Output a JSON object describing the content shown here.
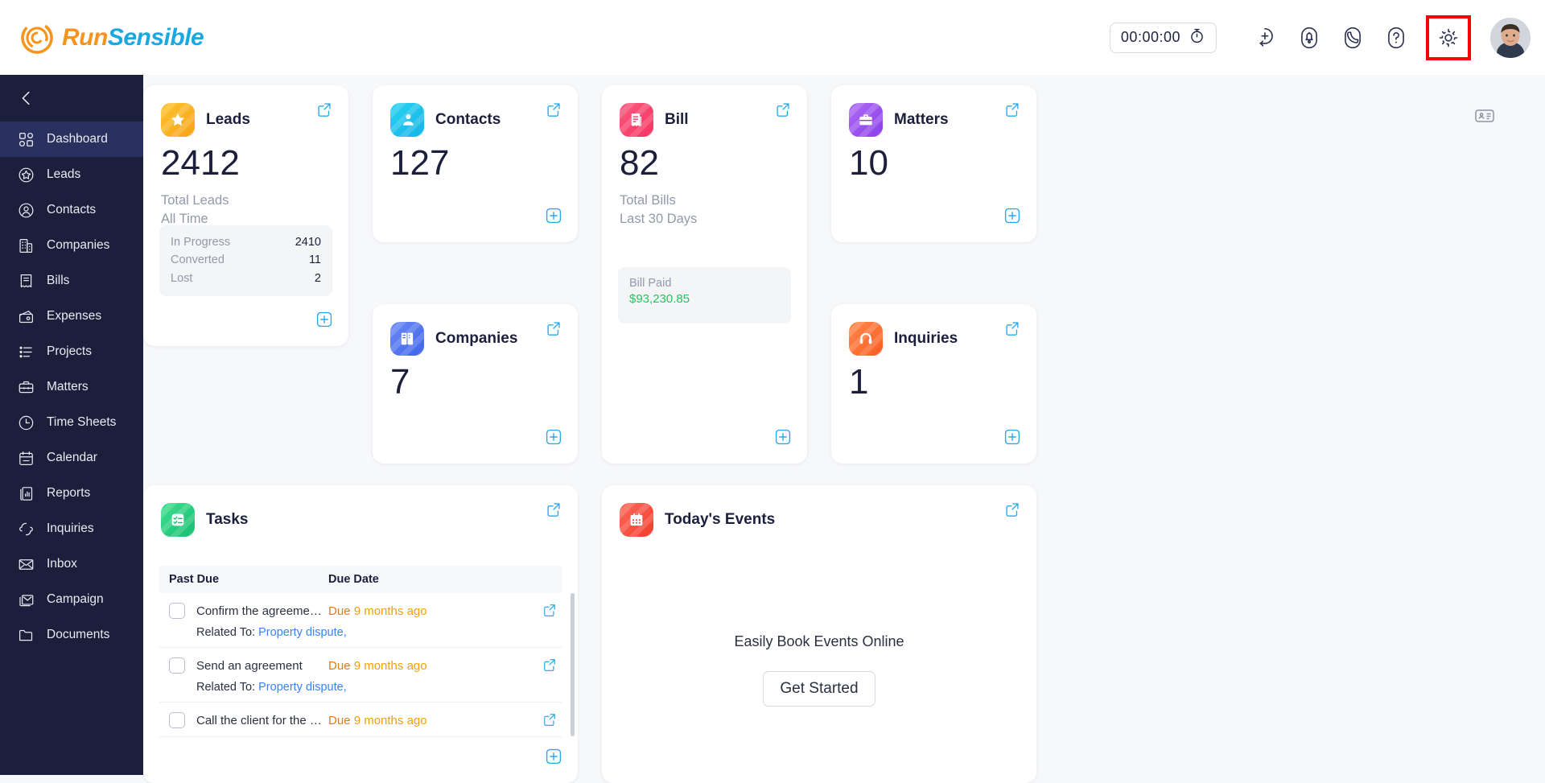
{
  "brand": {
    "run": "Run",
    "sensible": "Sensible"
  },
  "header": {
    "timer": "00:00:00",
    "icons": [
      {
        "name": "stopwatch-icon"
      },
      {
        "name": "add-circle-icon"
      },
      {
        "name": "bell-icon"
      },
      {
        "name": "phone-icon"
      },
      {
        "name": "help-icon"
      },
      {
        "name": "gear-icon"
      },
      {
        "name": "avatar"
      }
    ]
  },
  "sidebar": {
    "collapse": "collapse-icon",
    "items": [
      {
        "label": "Dashboard",
        "icon": "dashboard-icon",
        "active": true
      },
      {
        "label": "Leads",
        "icon": "star-icon",
        "active": false
      },
      {
        "label": "Contacts",
        "icon": "person-icon",
        "active": false
      },
      {
        "label": "Companies",
        "icon": "building-icon",
        "active": false
      },
      {
        "label": "Bills",
        "icon": "receipt-icon",
        "active": false
      },
      {
        "label": "Expenses",
        "icon": "wallet-icon",
        "active": false
      },
      {
        "label": "Projects",
        "icon": "list-icon",
        "active": false
      },
      {
        "label": "Matters",
        "icon": "briefcase-icon",
        "active": false
      },
      {
        "label": "Time Sheets",
        "icon": "clock-icon",
        "active": false
      },
      {
        "label": "Calendar",
        "icon": "calendar-icon",
        "active": false
      },
      {
        "label": "Reports",
        "icon": "report-icon",
        "active": false
      },
      {
        "label": "Inquiries",
        "icon": "headset-icon",
        "active": false
      },
      {
        "label": "Inbox",
        "icon": "envelope-icon",
        "active": false
      },
      {
        "label": "Campaign",
        "icon": "campaign-icon",
        "active": false
      },
      {
        "label": "Documents",
        "icon": "folder-icon",
        "active": false
      }
    ]
  },
  "cards": {
    "leads": {
      "title": "Leads",
      "value": "2412",
      "sub_line1": "Total Leads",
      "sub_line2": "All Time",
      "stats": [
        {
          "key": "In Progress",
          "value": "2410"
        },
        {
          "key": "Converted",
          "value": "11"
        },
        {
          "key": "Lost",
          "value": "2"
        }
      ]
    },
    "contacts": {
      "title": "Contacts",
      "value": "127"
    },
    "companies": {
      "title": "Companies",
      "value": "7"
    },
    "bill": {
      "title": "Bill",
      "value": "82",
      "sub_line1": "Total Bills",
      "sub_line2": "Last 30 Days",
      "paid_label": "Bill Paid",
      "paid_value": "$93,230.85"
    },
    "matters": {
      "title": "Matters",
      "value": "10"
    },
    "inquiries": {
      "title": "Inquiries",
      "value": "1"
    }
  },
  "tasks": {
    "title": "Tasks",
    "columns": {
      "name": "Past Due",
      "due": "Due Date"
    },
    "related_label": "Related To:",
    "rows": [
      {
        "title": "Confirm the agreeme…",
        "due_word": "Due",
        "due_rel": "9 months ago",
        "related": "Property dispute,"
      },
      {
        "title": "Send an agreement",
        "due_word": "Due",
        "due_rel": "9 months ago",
        "related": "Property dispute,"
      },
      {
        "title": "Call the client for the …",
        "due_word": "Due",
        "due_rel": "9 months ago",
        "related": ""
      }
    ]
  },
  "events": {
    "title": "Today's Events",
    "empty_text": "Easily Book Events Online",
    "cta": "Get Started"
  },
  "colors": {
    "sidebar_bg": "#1b1f3b",
    "accent_blue": "#29A9E8",
    "orange": "#f59e0b",
    "green": "#22c55e",
    "highlight": "#fb0007"
  }
}
